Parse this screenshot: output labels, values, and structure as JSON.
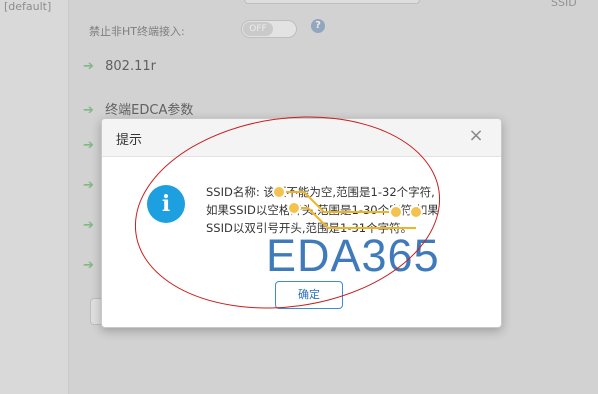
{
  "sidebar": {
    "default_text": "[default]"
  },
  "header": {
    "ssid_label": "SSID"
  },
  "settings": {
    "row_label": "禁止非HT终端接入:",
    "toggle_value": "OFF",
    "help_icon": "?"
  },
  "sections": [
    {
      "label": "802.11r"
    },
    {
      "label": "终端EDCA参数"
    }
  ],
  "dialog": {
    "title": "提示",
    "close_glyph": "×",
    "message": "SSID名称: 该项不能为空,范围是1-32个字符,如果SSID以空格开头,范围是1-30个字符,如果SSID以双引号开头,范围是1-31个字符。",
    "ok_label": "确定"
  },
  "watermark": {
    "text": "EDA365"
  },
  "colors": {
    "accent_blue": "#1e9fe0",
    "arrow_green": "#8fc78f",
    "annotation_red": "#c81f1f"
  }
}
